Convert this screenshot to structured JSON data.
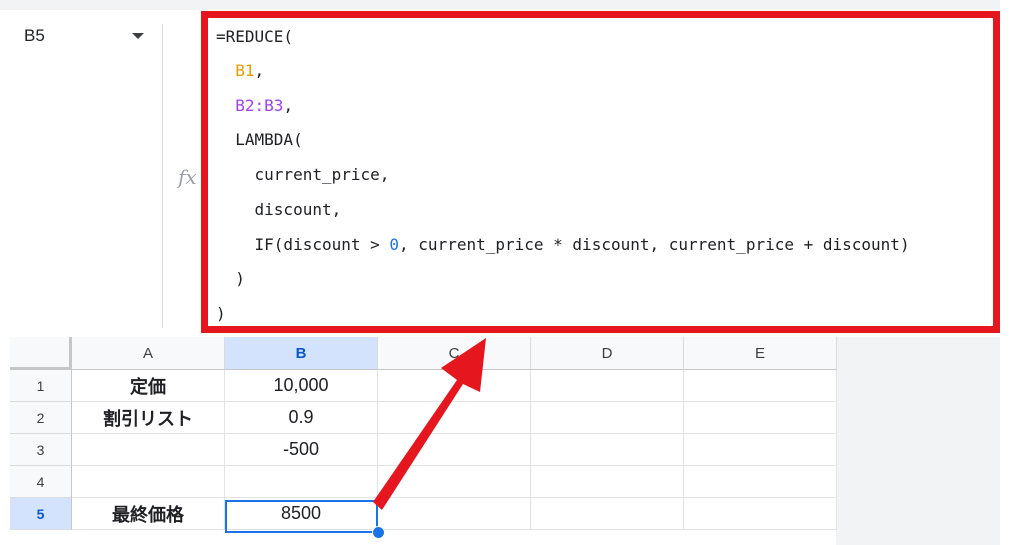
{
  "name_box": {
    "ref": "B5"
  },
  "fx_label": "fx",
  "formula_lines": [
    [
      {
        "text": "=REDUCE(",
        "color": "#202124"
      }
    ],
    [
      {
        "text": "  ",
        "color": "#202124"
      },
      {
        "text": "B1",
        "color": "#f29900"
      },
      {
        "text": ",",
        "color": "#202124"
      }
    ],
    [
      {
        "text": "  ",
        "color": "#202124"
      },
      {
        "text": "B2:B3",
        "color": "#a142f4"
      },
      {
        "text": ",",
        "color": "#202124"
      }
    ],
    [
      {
        "text": "  LAMBDA(",
        "color": "#202124"
      }
    ],
    [
      {
        "text": "    current_price,",
        "color": "#202124"
      }
    ],
    [
      {
        "text": "    discount,",
        "color": "#202124"
      }
    ],
    [
      {
        "text": "    IF(discount > ",
        "color": "#202124"
      },
      {
        "text": "0",
        "color": "#1a73e8"
      },
      {
        "text": ", current_price * discount, current_price + discount)",
        "color": "#202124"
      }
    ],
    [
      {
        "text": "  )",
        "color": "#202124"
      }
    ],
    [
      {
        "text": ")",
        "color": "#202124"
      }
    ]
  ],
  "columns": [
    "A",
    "B",
    "C",
    "D",
    "E"
  ],
  "selected_column": "B",
  "rows": [
    {
      "num": "1",
      "cells": [
        "定価",
        "10,000",
        "",
        "",
        ""
      ]
    },
    {
      "num": "2",
      "cells": [
        "割引リスト",
        "0.9",
        "",
        "",
        ""
      ]
    },
    {
      "num": "3",
      "cells": [
        "",
        "-500",
        "",
        "",
        ""
      ]
    },
    {
      "num": "4",
      "cells": [
        "",
        "",
        "",
        "",
        ""
      ]
    },
    {
      "num": "5",
      "cells": [
        "最終価格",
        "8500",
        "",
        "",
        ""
      ]
    }
  ],
  "selected_row": "5",
  "colors": {
    "highlight_box": "#e5161e",
    "selection": "#1a73e8"
  }
}
